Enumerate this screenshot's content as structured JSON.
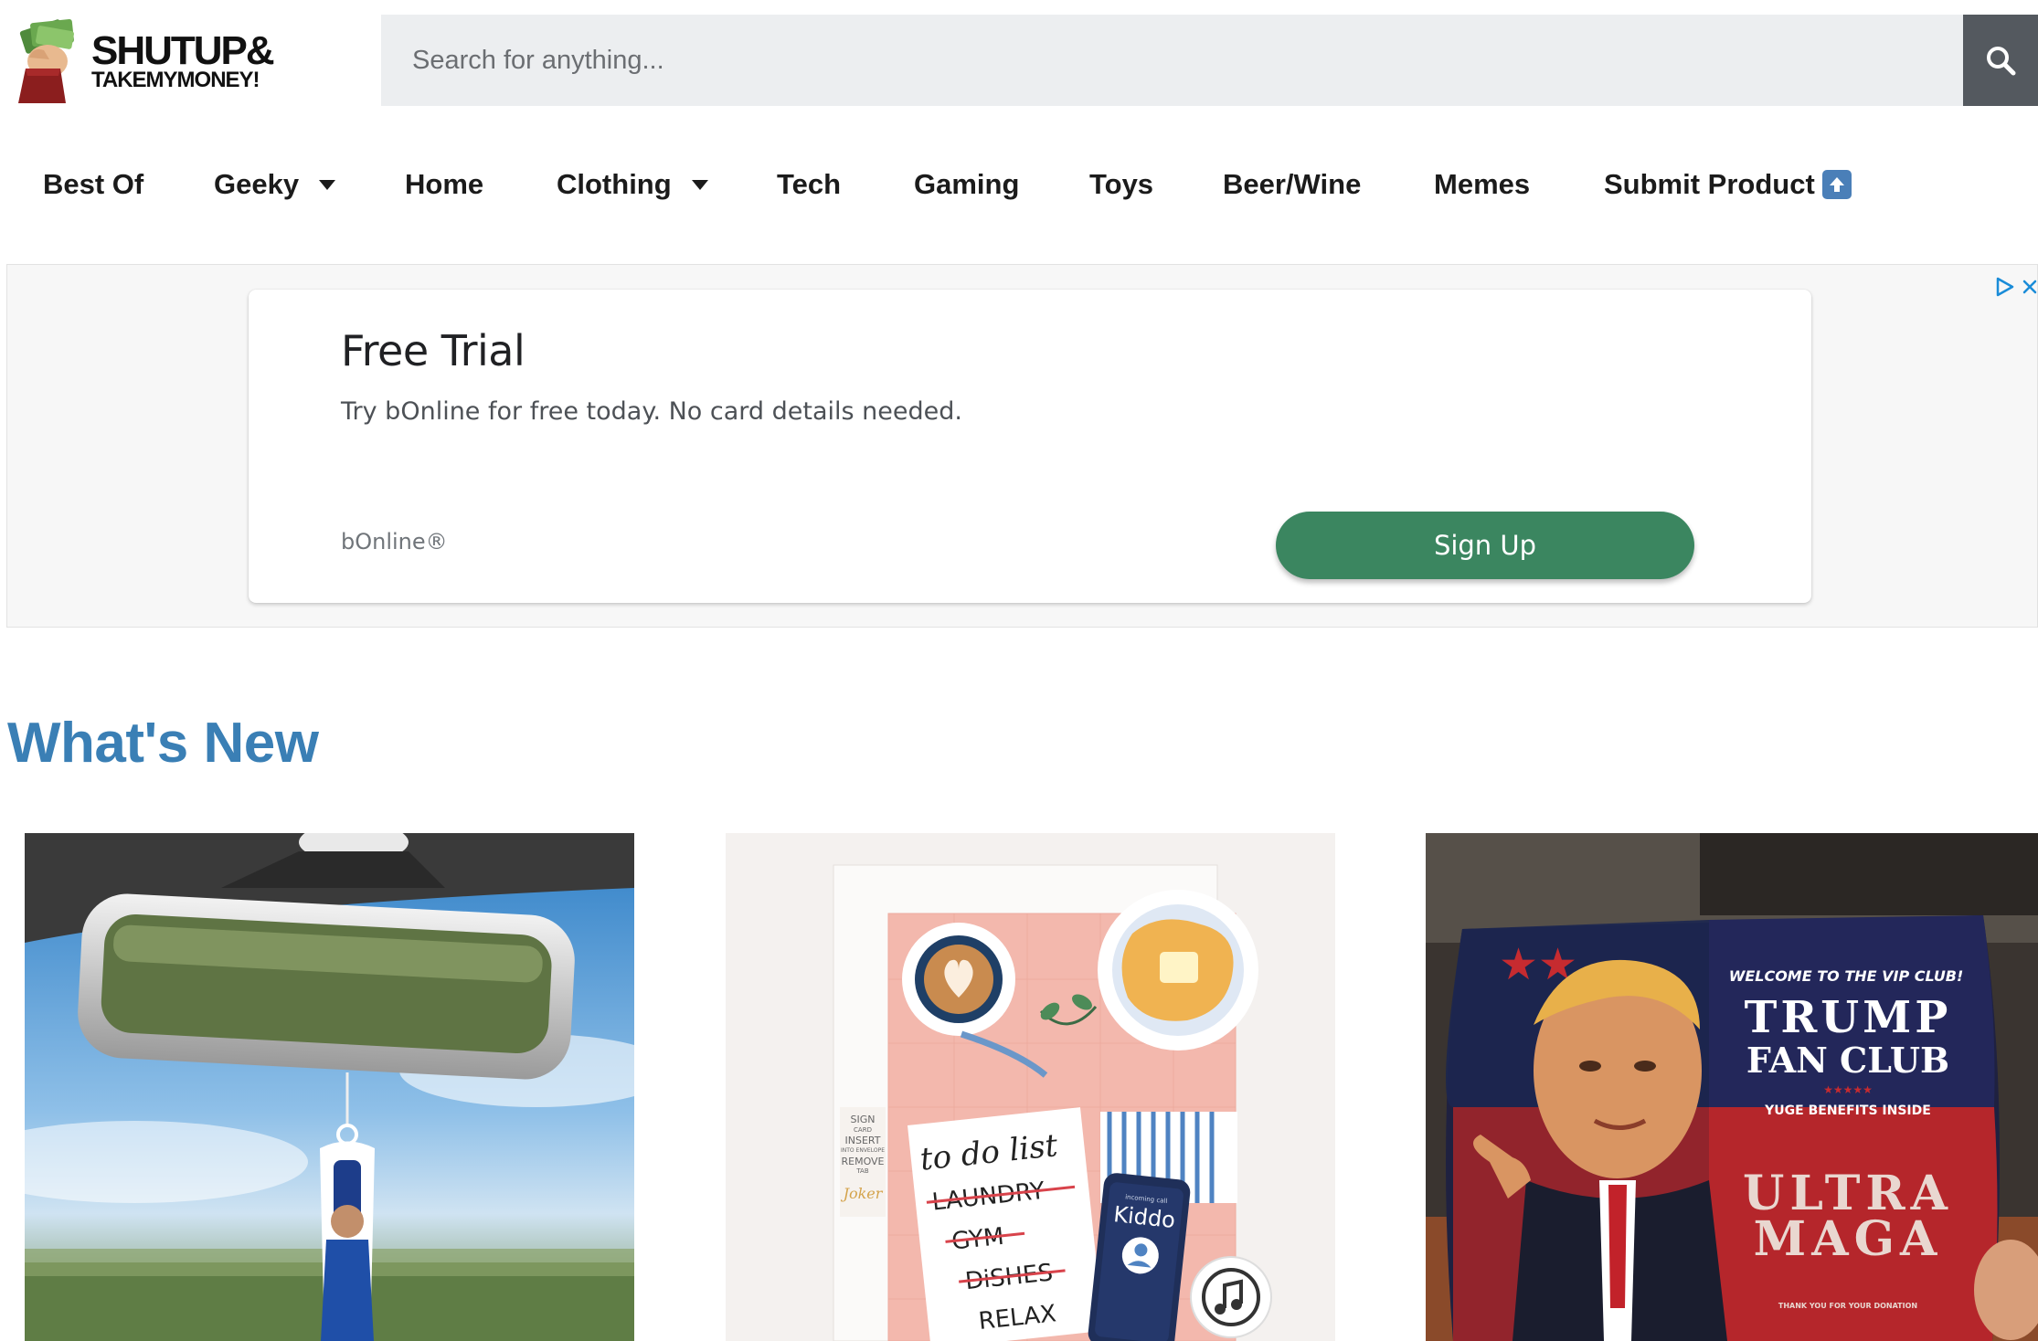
{
  "header": {
    "logo": {
      "line1": "SHUTUP&",
      "line2": "TAKEMYMONEY!"
    },
    "search": {
      "placeholder": "Search for anything...",
      "button_icon": "search-icon"
    }
  },
  "nav": {
    "items": [
      {
        "label": "Best Of",
        "has_dropdown": false
      },
      {
        "label": "Geeky",
        "has_dropdown": true
      },
      {
        "label": "Home",
        "has_dropdown": false
      },
      {
        "label": "Clothing",
        "has_dropdown": true
      },
      {
        "label": "Tech",
        "has_dropdown": false
      },
      {
        "label": "Gaming",
        "has_dropdown": false
      },
      {
        "label": "Toys",
        "has_dropdown": false
      },
      {
        "label": "Beer/Wine",
        "has_dropdown": false
      },
      {
        "label": "Memes",
        "has_dropdown": false
      },
      {
        "label": "Submit Product",
        "has_dropdown": false,
        "icon": "up-arrow-icon"
      }
    ]
  },
  "ad": {
    "title": "Free Trial",
    "description": "Try bOnline for free today. No card details needed.",
    "brand": "bOnline®",
    "cta": "Sign Up",
    "cta_color": "#3b8660",
    "badges": [
      "adchoices-icon",
      "close-icon"
    ]
  },
  "section": {
    "title": "What's New",
    "title_color": "#3a7fb5"
  },
  "products": [
    {
      "image": "air-freshener-mirror-image"
    },
    {
      "image": "to-do-list-card-image",
      "card_text": {
        "todo_title": "to do list",
        "todo_items": [
          "LAUNDRY",
          "GYM",
          "DiSHES",
          "RELAX"
        ],
        "phone_label": "Kiddo",
        "phone_caption": "incoming call",
        "side_instructions": [
          "SIGN",
          "CARD",
          "INSERT",
          "INTO ENVELOPE",
          "REMOVE",
          "TAB"
        ],
        "side_brand": "Joker"
      }
    },
    {
      "image": "trump-fan-club-package-image",
      "package_text": {
        "tagline": "WELCOME TO THE VIP CLUB!",
        "title_line1": "TRUMP",
        "title_line2": "FAN CLUB",
        "stars": "★★★★★",
        "subtitle": "YUGE BENEFITS INSIDE",
        "slogan_line1": "ULTRA",
        "slogan_line2": "MAGA",
        "footer": "THANK YOU FOR YOUR DONATION"
      }
    }
  ]
}
